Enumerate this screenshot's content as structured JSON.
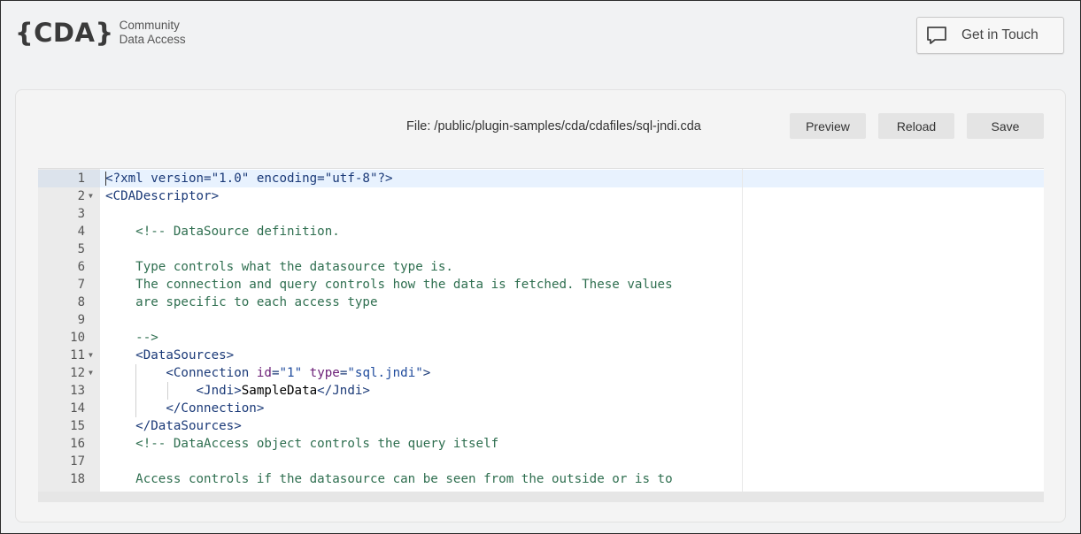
{
  "header": {
    "logo_mark": "{CDA}",
    "logo_line1": "Community",
    "logo_line2": "Data Access",
    "contact_label": "Get in Touch"
  },
  "toolbar": {
    "file_path": "File: /public/plugin-samples/cda/cdafiles/sql-jndi.cda",
    "preview_label": "Preview",
    "reload_label": "Reload",
    "save_label": "Save"
  },
  "editor": {
    "lines": [
      {
        "n": "1",
        "fold": false,
        "segments": [
          {
            "t": "<?xml version=\"1.0\" encoding=\"utf-8\"?>",
            "c": "c-tag"
          }
        ]
      },
      {
        "n": "2",
        "fold": true,
        "segments": [
          {
            "t": "<CDADescriptor>",
            "c": "c-tag"
          }
        ]
      },
      {
        "n": "3",
        "fold": false,
        "segments": []
      },
      {
        "n": "4",
        "fold": false,
        "segments": [
          {
            "t": "    <!-- DataSource definition.",
            "c": "c-comment"
          }
        ]
      },
      {
        "n": "5",
        "fold": false,
        "segments": []
      },
      {
        "n": "6",
        "fold": false,
        "segments": [
          {
            "t": "    Type controls what the datasource type is.",
            "c": "c-comment"
          }
        ]
      },
      {
        "n": "7",
        "fold": false,
        "segments": [
          {
            "t": "    The connection and query controls how the data is fetched. These values",
            "c": "c-comment"
          }
        ]
      },
      {
        "n": "8",
        "fold": false,
        "segments": [
          {
            "t": "    are specific to each access type",
            "c": "c-comment"
          }
        ]
      },
      {
        "n": "9",
        "fold": false,
        "segments": []
      },
      {
        "n": "10",
        "fold": false,
        "segments": [
          {
            "t": "    -->",
            "c": "c-comment"
          }
        ]
      },
      {
        "n": "11",
        "fold": true,
        "segments": [
          {
            "t": "    <DataSources>",
            "c": "c-tag"
          }
        ]
      },
      {
        "n": "12",
        "fold": true,
        "segments": [
          {
            "t": "        <Connection ",
            "c": "c-tag"
          },
          {
            "t": "id",
            "c": "c-attr"
          },
          {
            "t": "=",
            "c": "c-tag"
          },
          {
            "t": "\"1\"",
            "c": "c-str"
          },
          {
            "t": " ",
            "c": "c-tag"
          },
          {
            "t": "type",
            "c": "c-attr"
          },
          {
            "t": "=",
            "c": "c-tag"
          },
          {
            "t": "\"sql.jndi\"",
            "c": "c-str"
          },
          {
            "t": ">",
            "c": "c-tag"
          }
        ]
      },
      {
        "n": "13",
        "fold": false,
        "segments": [
          {
            "t": "            <Jndi>",
            "c": "c-tag"
          },
          {
            "t": "SampleData",
            "c": "c-text"
          },
          {
            "t": "</Jndi>",
            "c": "c-tag"
          }
        ]
      },
      {
        "n": "14",
        "fold": false,
        "segments": [
          {
            "t": "        </Connection>",
            "c": "c-tag"
          }
        ]
      },
      {
        "n": "15",
        "fold": false,
        "segments": [
          {
            "t": "    </DataSources>",
            "c": "c-tag"
          }
        ]
      },
      {
        "n": "16",
        "fold": false,
        "segments": [
          {
            "t": "    <!-- DataAccess object controls the query itself",
            "c": "c-comment"
          }
        ]
      },
      {
        "n": "17",
        "fold": false,
        "segments": []
      },
      {
        "n": "18",
        "fold": false,
        "segments": [
          {
            "t": "    Access controls if the datasource can be seen from the outside or is to",
            "c": "c-comment"
          }
        ]
      }
    ]
  },
  "colors": {
    "background": "#f1f2f3",
    "active_line": "#e8f2fe",
    "tag": "#1b3a78",
    "comment": "#2f6f50",
    "attribute": "#6b1e76",
    "string": "#1e4a9c"
  }
}
